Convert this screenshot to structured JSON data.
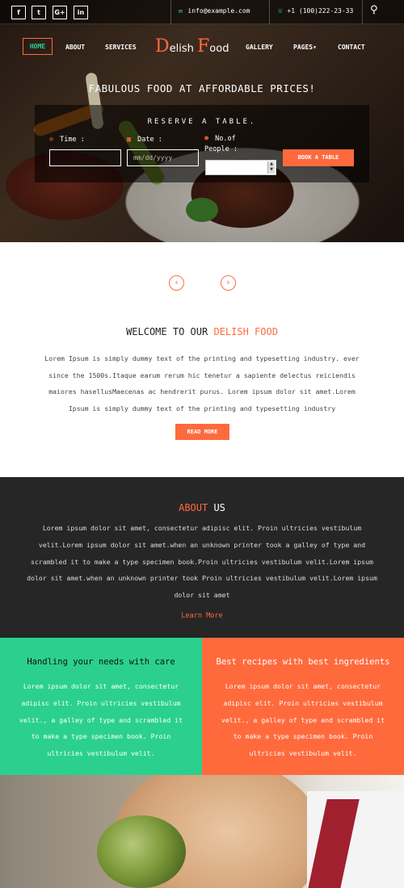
{
  "topbar": {
    "social": [
      "f",
      "t",
      "G+",
      "in"
    ],
    "email_icon": "envelope-icon",
    "email": "info@example.com",
    "phone_icon": "phone-icon",
    "phone": "+1 (100)222-23-33"
  },
  "nav": {
    "items": [
      "HOME",
      "ABOUT",
      "SERVICES",
      "GALLERY",
      "PAGES",
      "CONTACT"
    ],
    "pages_caret": "▾",
    "logo_d": "D",
    "logo_elish": "elish",
    "logo_f": "F",
    "logo_ood": "ood"
  },
  "hero": {
    "tagline": "FABULOUS FOOD AT AFFORDABLE PRICES!"
  },
  "reserve": {
    "title": "RESERVE A TABLE.",
    "time_label": "Time :",
    "date_label": "Date :",
    "date_placeholder": "mm/dd/yyyy",
    "people_label": "No.of",
    "people_label2": "People :",
    "book_label": "BOOK A TABLE"
  },
  "welcome": {
    "arrow_left": "‹",
    "arrow_right": "›",
    "title_prefix": "WELCOME TO OUR",
    "title_highlight": "DELISH FOOD",
    "text": "Lorem Ipsum is simply dummy text of the printing and typesetting industry. ever since the 1500s.Itaque earum rerum hic tenetur a sapiente delectus reiciendis maiores hasellusMaecenas ac hendrerit purus. Lorem ipsum dolor sit amet.Lorem Ipsum is simply dummy text of the printing and typesetting industry",
    "read_more": "READ MORE"
  },
  "about": {
    "title_highlight": "ABOUT",
    "title_rest": "US",
    "text": "Lorem ipsum dolor sit amet, consectetur adipisc elit. Proin ultricies vestibulum velit.Lorem ipsum dolor sit amet.when an unknown printer took a galley of type and scrambled it to make a type specimen book.Proin ultricies vestibulum velit.Lorem ipsum dolor sit amet.when an unknown printer took Proin ultricies vestibulum velit.Lorem ipsum dolor sit amet",
    "learn_more": "Learn More"
  },
  "features": [
    {
      "title": "Handling your needs with care",
      "text": "Lorem ipsum dolor sit amet, consectetur adipisc elit. Proin ultricies vestibulum velit., a galley of type and scrambled it to make a type specimen book. Proin ultricies vestibulum velit."
    },
    {
      "title": "Best recipes with best ingredients",
      "text": "Lorem ipsum dolor sit amet, consectetur adipisc elit. Proin ultricies vestibulum velit., a galley of type and scrambled it to make a type specimen book. Proin ultricies vestibulum velit."
    }
  ],
  "colors": {
    "accent": "#ff6a3d",
    "green": "#2bd08f",
    "dark": "#262626"
  }
}
